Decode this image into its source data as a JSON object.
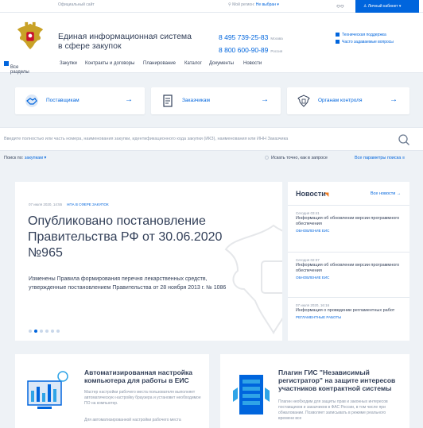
{
  "topbar": {
    "official": "Официальный сайт",
    "region_label": "Мой регион:",
    "region_value": "Не выбран ▾",
    "cabinet": "Личный кабинет ▾"
  },
  "header": {
    "title_line1": "Единая информационная система",
    "title_line2": "в сфере закупок",
    "phone1": "8 495 739-25-83",
    "phone1_city": "Москва",
    "phone2": "8 800 600-90-89",
    "phone2_city": "Россия",
    "support": "Техническая поддержка",
    "faq": "Часто задаваемые вопросы"
  },
  "nav": {
    "items": [
      "Все разделы",
      "Закупки",
      "Контракты и договоры",
      "Планирование",
      "Каталог",
      "Документы",
      "Новости"
    ]
  },
  "cards": [
    {
      "label": "Поставщикам",
      "icon": "handshake-icon"
    },
    {
      "label": "Заказчикам",
      "icon": "document-icon"
    },
    {
      "label": "Органам контроля",
      "icon": "emblem-icon"
    }
  ],
  "search": {
    "placeholder": "Введите полностью или часть номера, наименования закупки, идентификационного кода закупки (ИКЗ), наименования или ИНН Заказчика",
    "scope_label": "Поиск по:",
    "scope_value": "закупкам ▾",
    "exact": "Искать точно, как в запросе",
    "all_params": "Все параметры поиска"
  },
  "news_main": {
    "date": "07 июля 2020, 14:55",
    "category": "НПА В СФЕРЕ ЗАКУПОК",
    "title": "Опубликовано постановление Правительства РФ от 30.06.2020 №965",
    "text": "Изменены Правила формирования перечня лекарственных средств, утвержденные постановлением Правительства от 28 ноября 2013 г. № 1086",
    "slides": 6,
    "active_slide": 2
  },
  "news_side": {
    "heading": "Новости",
    "all_link": "Все новости",
    "items": [
      {
        "date": "Сегодня 03:41",
        "title": "Информация об обновлении версии программного обеспечения",
        "category": "ОБНОВЛЕНИЕ ЕИС"
      },
      {
        "date": "Сегодня 02:37",
        "title": "Информация об обновлении версии программного обеспечения",
        "category": "ОБНОВЛЕНИЕ ЕИС"
      },
      {
        "date": "07 июля 2020, 16:16",
        "title": "Информация о проведении регламентных работ",
        "category": "РЕГЛАМЕНТНЫЕ РАБОТЫ"
      }
    ]
  },
  "promos": [
    {
      "title": "Автоматизированная настройка компьютера для работы в ЕИС",
      "desc1": "Мастер настройки рабочего места пользователя выполняет автоматическую настройку браузера и установит необходимое ПО на компьютер.",
      "desc2": "Для автоматизированной настройки рабочего места"
    },
    {
      "title": "Плагин ГИС \"Независимый регистратор\" на защите интересов участников контрактной системы",
      "desc1": "Плагин необходим для защиты прав и законных интересов поставщиков и заказчиков в ФАС России, в том числе при обжаловании. Позволяет записывать в режиме реального времени все"
    }
  ]
}
